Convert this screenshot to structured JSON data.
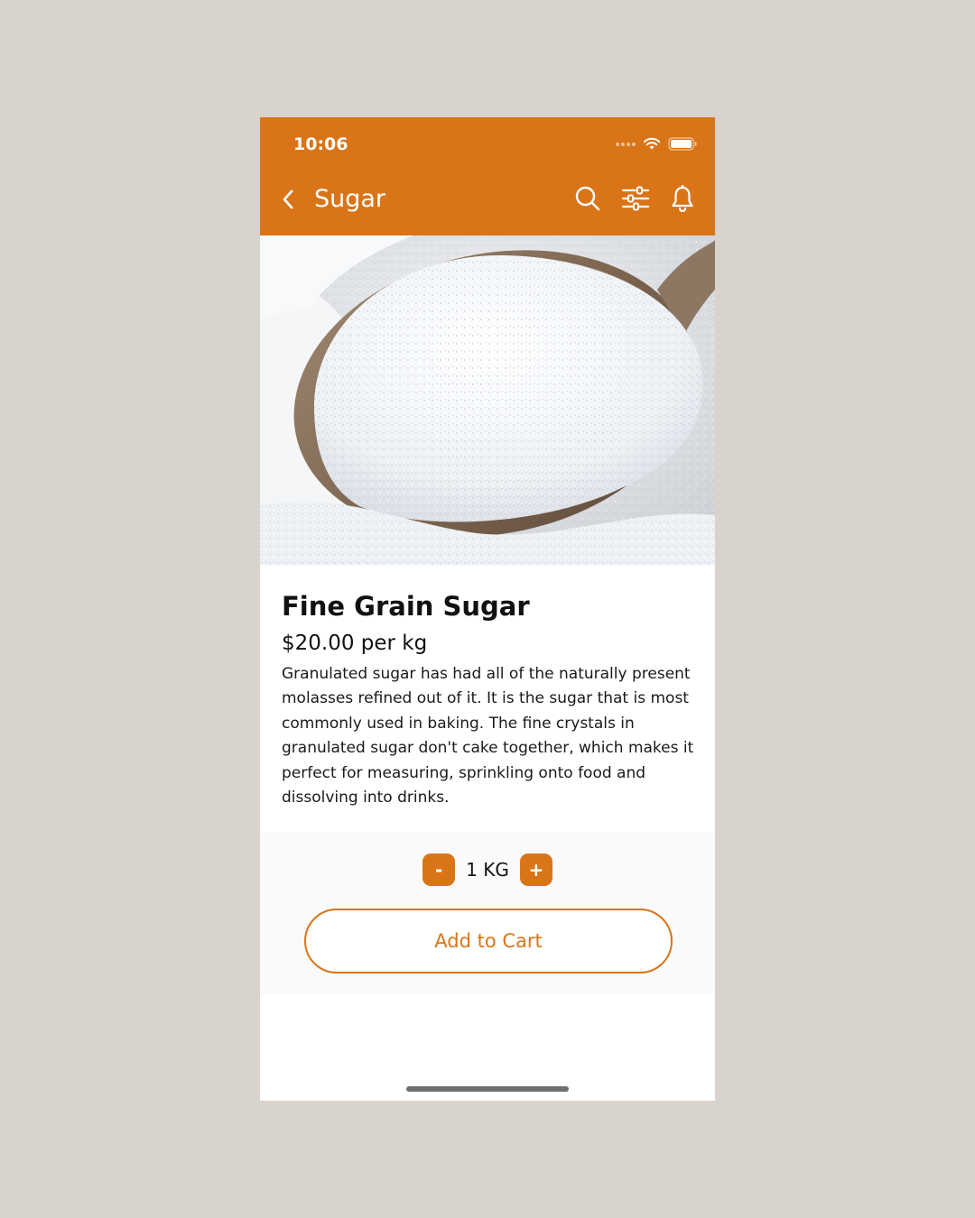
{
  "status_bar": {
    "time": "10:06"
  },
  "header": {
    "title": "Sugar",
    "back_icon": "chevron-left-icon",
    "actions": [
      "search-icon",
      "filter-icon",
      "bell-icon"
    ]
  },
  "product": {
    "name": "Fine Grain Sugar",
    "price": "$20.00 per kg",
    "description": "Granulated sugar has had all of the naturally present molasses refined out of it. It is the sugar that is most commonly used in baking. The fine crystals in granulated sugar don't cake together, which makes it perfect for measuring, sprinkling onto food and dissolving into drinks."
  },
  "quantity": {
    "decrement_label": "-",
    "value": "1 KG",
    "increment_label": "+"
  },
  "cart": {
    "button_label": "Add to Cart"
  },
  "colors": {
    "accent": "#d97518",
    "background": "#d8d3cd"
  }
}
